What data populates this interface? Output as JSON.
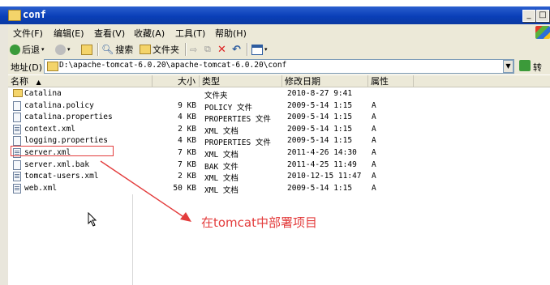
{
  "window": {
    "title": "conf",
    "min_label": "_",
    "max_label": "□"
  },
  "menu": [
    {
      "label": "文件(F)"
    },
    {
      "label": "编辑(E)"
    },
    {
      "label": "查看(V)"
    },
    {
      "label": "收藏(A)"
    },
    {
      "label": "工具(T)"
    },
    {
      "label": "帮助(H)"
    }
  ],
  "toolbar": {
    "back_label": "后退",
    "search_label": "搜索",
    "folders_label": "文件夹"
  },
  "address": {
    "label": "地址(D)",
    "path": "D:\\apache-tomcat-6.0.20\\apache-tomcat-6.0.20\\conf",
    "go_label": "转到"
  },
  "columns": {
    "name": "名称",
    "size": "大小",
    "type": "类型",
    "modified": "修改日期",
    "attributes": "属性"
  },
  "files": [
    {
      "name": "Catalina",
      "size": "",
      "type": "文件夹",
      "modified": "2010-8-27 9:41",
      "attr": "",
      "icon": "folder-icon"
    },
    {
      "name": "catalina.policy",
      "size": "9 KB",
      "type": "POLICY 文件",
      "modified": "2009-5-14 1:15",
      "attr": "A",
      "icon": "file-icon"
    },
    {
      "name": "catalina.properties",
      "size": "4 KB",
      "type": "PROPERTIES 文件",
      "modified": "2009-5-14 1:15",
      "attr": "A",
      "icon": "file-icon"
    },
    {
      "name": "context.xml",
      "size": "2 KB",
      "type": "XML 文档",
      "modified": "2009-5-14 1:15",
      "attr": "A",
      "icon": "xml-file-icon"
    },
    {
      "name": "logging.properties",
      "size": "4 KB",
      "type": "PROPERTIES 文件",
      "modified": "2009-5-14 1:15",
      "attr": "A",
      "icon": "file-icon"
    },
    {
      "name": "server.xml",
      "size": "7 KB",
      "type": "XML 文档",
      "modified": "2011-4-26 14:30",
      "attr": "A",
      "icon": "xml-file-icon"
    },
    {
      "name": "server.xml.bak",
      "size": "7 KB",
      "type": "BAK 文件",
      "modified": "2011-4-25 11:49",
      "attr": "A",
      "icon": "file-icon"
    },
    {
      "name": "tomcat-users.xml",
      "size": "2 KB",
      "type": "XML 文档",
      "modified": "2010-12-15 11:47",
      "attr": "A",
      "icon": "xml-file-icon"
    },
    {
      "name": "web.xml",
      "size": "50 KB",
      "type": "XML 文档",
      "modified": "2009-5-14 1:15",
      "attr": "A",
      "icon": "xml-file-icon"
    }
  ],
  "annotation": {
    "text": "在tomcat中部署项目",
    "color": "#e33c3c"
  },
  "colors": {
    "titlebar": "#0a3fb8",
    "chrome": "#ece9d8",
    "accent_red": "#e33c3c"
  }
}
